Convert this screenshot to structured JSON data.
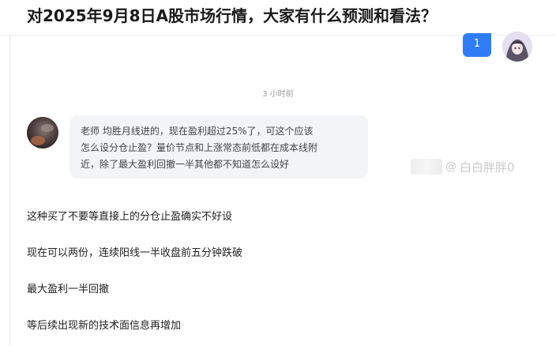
{
  "question": {
    "title": "对2025年9月8日A股市场行情，大家有什么预测和看法？"
  },
  "chat": {
    "my_message": {
      "text": "1"
    },
    "timestamp": "3 小时前",
    "incoming_message": {
      "lines": [
        "老师   均胜月线进的，现在盈利超过25%了，可这个应该",
        "怎么设分仓止盈？量价节点和上涨常态前低都在成本线附",
        "近，除了最大盈利回撤一半其他都不知道怎么设好"
      ]
    },
    "watermark": {
      "text": "白白胖胖0"
    }
  },
  "reply": {
    "lines": [
      "这种买了不要等直接上的分仓止盈确实不好设",
      "现在可以两份，连续阳线一半收盘前五分钟跌破",
      "最大盈利一半回撤",
      "等后续出现新的技术面信息再增加"
    ]
  },
  "colors": {
    "accent_blue": "#2f7cf6",
    "bubble_gray": "#f3f4f6",
    "timestamp_gray": "#9a9a9a"
  }
}
